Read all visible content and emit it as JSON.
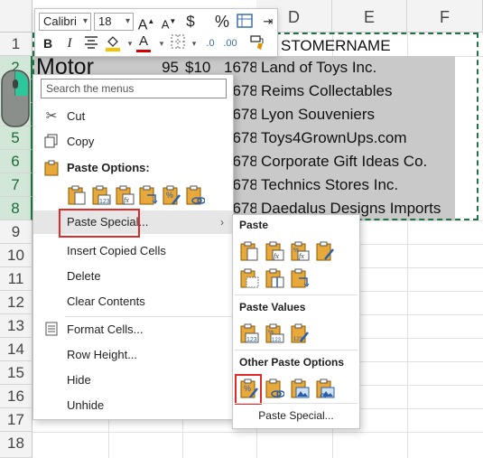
{
  "columns": [
    "D",
    "E",
    "F"
  ],
  "rows": [
    "1",
    "2",
    "3",
    "4",
    "5",
    "6",
    "7",
    "8",
    "9",
    "10",
    "11",
    "12",
    "13",
    "14",
    "15",
    "16",
    "17",
    "18"
  ],
  "cells": {
    "a2": "Motor",
    "b2": "95",
    "c2": "$10",
    "col_c_rows": [
      "1678",
      "1678",
      "1678",
      "1678",
      "1678",
      "1678",
      "1678"
    ],
    "header_d1": "STOMERNAME",
    "customers": [
      "Land of Toys Inc.",
      "Reims Collectables",
      "Lyon Souveniers",
      "Toys4GrownUps.com",
      "Corporate Gift Ideas Co.",
      "Technics Stores Inc.",
      "Daedalus Designs Imports"
    ]
  },
  "mini_toolbar": {
    "font": "Calibri",
    "size": "18",
    "increase_font": "A",
    "decrease_font": "A",
    "currency": "$",
    "percent": "%",
    "bold": "B",
    "italic": "I",
    "font_color_letter": "A",
    "accent_fill": "#f5c400",
    "accent_font": "#d40000"
  },
  "context_menu": {
    "search_placeholder": "Search the menus",
    "cut": "Cut",
    "copy": "Copy",
    "paste_options_header": "Paste Options:",
    "paste_special": "Paste Special...",
    "insert_copied_cells": "Insert Copied Cells",
    "delete": "Delete",
    "clear_contents": "Clear Contents",
    "format_cells": "Format Cells...",
    "row_height": "Row Height...",
    "hide": "Hide",
    "unhide": "Unhide",
    "submenu_arrow": "›",
    "icons": {
      "cut": "scissors-icon",
      "copy": "copy-icon",
      "paste": "clipboard-icon",
      "format": "format-cells-icon"
    }
  },
  "submenu": {
    "paste_header": "Paste",
    "paste_values_header": "Paste Values",
    "other_header": "Other Paste Options",
    "paste_special_link": "Paste Special...",
    "values_123": "123",
    "percent_glyph": "%",
    "fx_glyph": "fx"
  },
  "highlight_color": "#e02b2b",
  "accent": "#217346"
}
